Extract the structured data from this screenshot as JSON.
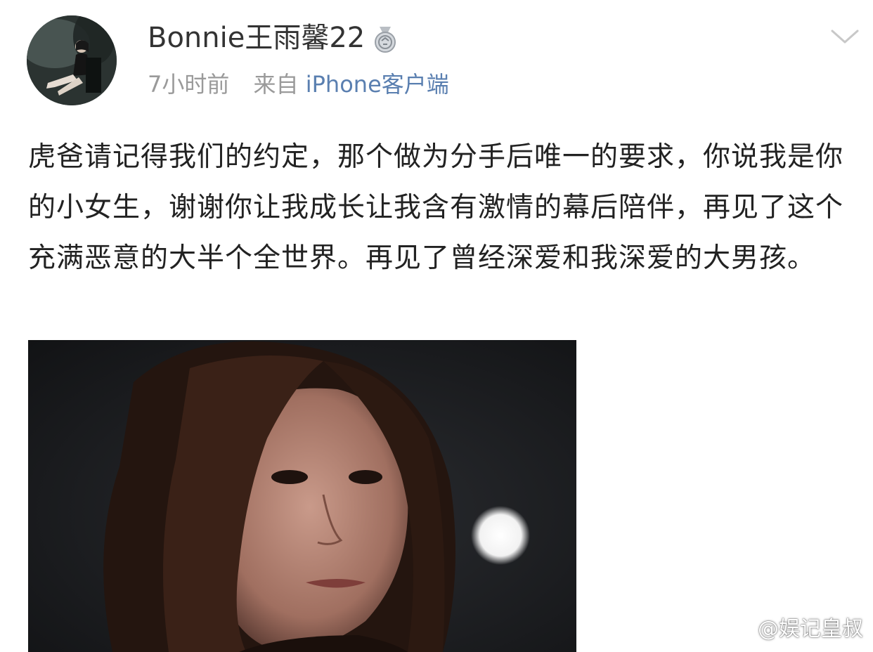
{
  "post": {
    "username": "Bonnie王雨馨22",
    "time": "7小时前",
    "source_prefix": "来自",
    "source_client": "iPhone客户端",
    "content": "虎爸请记得我们的约定，那个做为分手后唯一的要求，你说我是你的小女生，谢谢你让我成长让我含有激情的幕后陪伴，再见了这个充满恶意的大半个全世界。再见了曾经深爱和我深爱的大男孩。"
  },
  "icons": {
    "medal": "medal-badge-icon",
    "more": "chevron-down-icon",
    "watermark": "weibo-logo-icon"
  },
  "watermark": {
    "text": "@娱记皇叔"
  },
  "colors": {
    "text": "#222222",
    "meta": "#9a9a9a",
    "link": "#5a7fb0",
    "chevron": "#c8c8c8"
  }
}
